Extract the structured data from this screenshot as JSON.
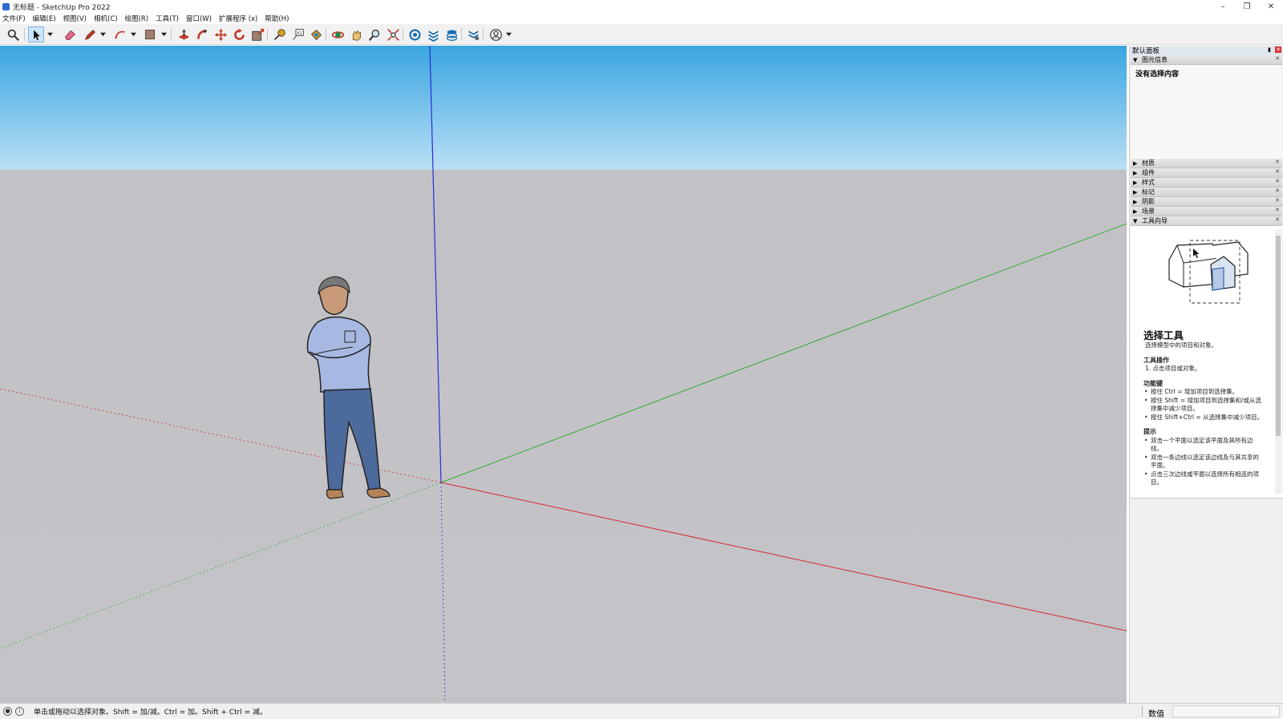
{
  "window": {
    "title": "无标题 - SketchUp Pro 2022",
    "controls": [
      "minimize-icon",
      "restore-icon",
      "close-icon"
    ]
  },
  "menu": [
    "文件(F)",
    "编辑(E)",
    "视图(V)",
    "相机(C)",
    "绘图(R)",
    "工具(T)",
    "窗口(W)",
    "扩展程序 (x)",
    "帮助(H)"
  ],
  "toolbar": {
    "tools": [
      "search-icon",
      "select-icon",
      "eraser-icon",
      "pencil-line-icon",
      "arc-icon",
      "rectangle-icon",
      "push-pull-icon",
      "follow-me-icon",
      "move-icon",
      "rotate-icon",
      "scale-icon",
      "tape-measure-icon",
      "text-icon",
      "paint-bucket-icon",
      "orbit-icon",
      "pan-icon",
      "zoom-icon",
      "zoom-extents-icon",
      "warehouse-icon",
      "extension-warehouse-icon",
      "layout-icon",
      "extension-manager-icon",
      "account-icon"
    ]
  },
  "panel": {
    "title": "默认面板",
    "entity_info": {
      "label": "图元信息",
      "body": "没有选择内容"
    },
    "trays": [
      "材质",
      "组件",
      "样式",
      "标记",
      "阴影",
      "场景"
    ],
    "instructor": {
      "label": "工具向导",
      "title": "选择工具",
      "subtitle": "选择模型中的项目和对象。",
      "ops_title": "工具操作",
      "ops": [
        "1. 点击项目或对象。"
      ],
      "keys_title": "功能键",
      "keys": [
        "按住 Ctrl = 增加项目到选择集。",
        "按住 Shift = 增加项目到选择集和/或从选择集中减少项目。",
        "按住 Shift+Ctrl = 从选择集中减少项目。"
      ],
      "tips_title": "提示",
      "tips": [
        "双击一个平面以选定该平面及其所有边线。",
        "双击一条边线以选定该边线及与其共享的平面。",
        "点击三次边线或平面以选择所有相连的项目。"
      ]
    }
  },
  "status": {
    "hint": "单击或拖动以选择对象。Shift = 加/减。Ctrl = 加。Shift + Ctrl = 减。",
    "value_label": "数值",
    "value": ""
  },
  "colors": {
    "sky_top": "#3aa5e0",
    "ground": "#c4c4c8",
    "axis_red": "#d42a2a",
    "axis_green": "#3aa63a",
    "axis_blue": "#2a2ad4"
  }
}
